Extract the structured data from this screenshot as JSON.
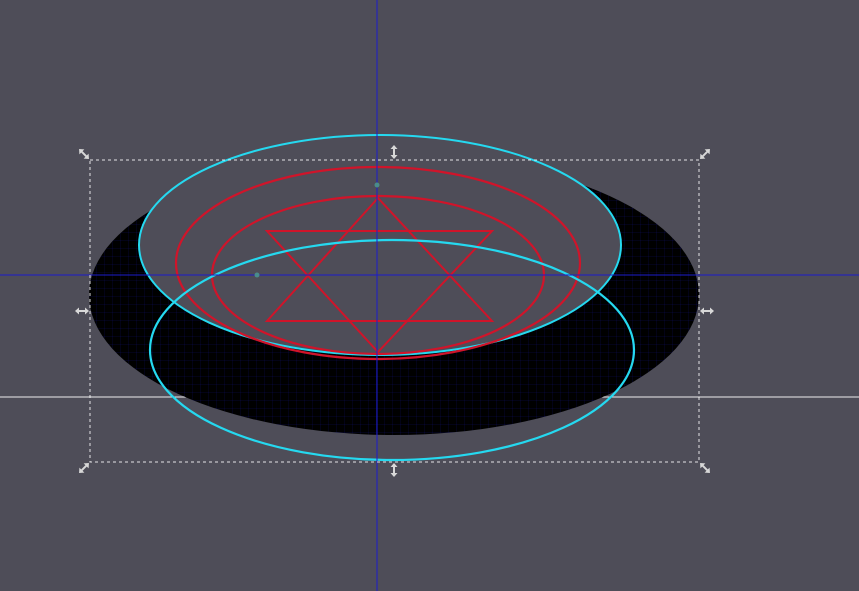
{
  "app": {
    "view": "vector-editor-canvas"
  },
  "canvas": {
    "background_color": "#4e4d58"
  },
  "colors": {
    "canvas_background": "#4e4d58",
    "shape_fill": "#000000",
    "highlight_fill": "#4e4d58",
    "cyan_stroke": "#25d9f0",
    "red_stroke": "#d0142a",
    "guide_line": "#1c1ccc",
    "grid_line": "#1d1ddc",
    "baseline": "#ffffff",
    "selection_box": "#ffffff",
    "handle": "#d8d8d8",
    "node_marker": "#4a8c8a"
  },
  "icons": {
    "corner_handle": "diagonal-double-arrow-icon",
    "vertical_handle": "vertical-double-arrow-icon",
    "horizontal_handle": "horizontal-double-arrow-icon",
    "node": "node-dot-icon"
  },
  "selection": {
    "active": true,
    "handles": [
      "top-left",
      "top-center",
      "top-right",
      "middle-left",
      "middle-right",
      "bottom-left",
      "bottom-center",
      "bottom-right"
    ]
  },
  "guides": {
    "vertical": 1,
    "horizontal": 1
  },
  "drawing": {
    "objects": [
      "black-ellipse",
      "top-cyan-ellipse",
      "bottom-cyan-ellipse",
      "outer-red-ring",
      "inner-red-ring",
      "hexagram"
    ]
  }
}
